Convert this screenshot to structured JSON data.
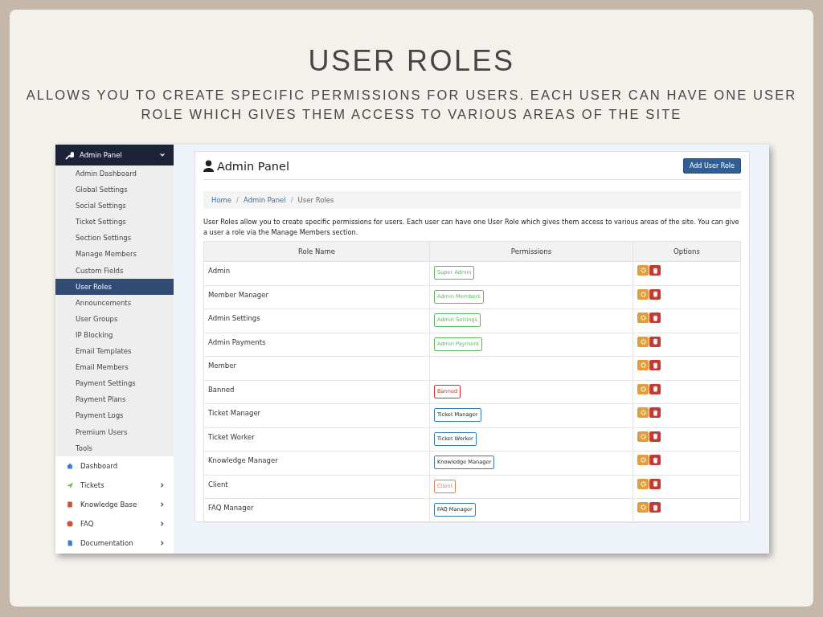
{
  "slide": {
    "title": "USER ROLES",
    "subtitle": "ALLOWS YOU TO CREATE SPECIFIC PERMISSIONS FOR USERS. EACH USER CAN HAVE ONE USER ROLE WHICH GIVES THEM ACCESS TO VARIOUS AREAS OF THE SITE"
  },
  "sidebar": {
    "section": {
      "label": "Admin Panel",
      "expanded": true
    },
    "items": [
      {
        "label": "Admin Dashboard",
        "selected": false
      },
      {
        "label": "Global Settings",
        "selected": false
      },
      {
        "label": "Social Settings",
        "selected": false
      },
      {
        "label": "Ticket Settings",
        "selected": false
      },
      {
        "label": "Section Settings",
        "selected": false
      },
      {
        "label": "Manage Members",
        "selected": false
      },
      {
        "label": "Custom Fields",
        "selected": false
      },
      {
        "label": "User Roles",
        "selected": true
      },
      {
        "label": "Announcements",
        "selected": false
      },
      {
        "label": "User Groups",
        "selected": false
      },
      {
        "label": "IP Blocking",
        "selected": false
      },
      {
        "label": "Email Templates",
        "selected": false
      },
      {
        "label": "Email Members",
        "selected": false
      },
      {
        "label": "Payment Settings",
        "selected": false
      },
      {
        "label": "Payment Plans",
        "selected": false
      },
      {
        "label": "Payment Logs",
        "selected": false
      },
      {
        "label": "Premium Users",
        "selected": false
      },
      {
        "label": "Tools",
        "selected": false
      }
    ],
    "nav": [
      {
        "label": "Dashboard",
        "kind": "home",
        "submenu": false
      },
      {
        "label": "Tickets",
        "kind": "send",
        "submenu": true
      },
      {
        "label": "Knowledge Base",
        "kind": "book",
        "submenu": true
      },
      {
        "label": "FAQ",
        "kind": "info",
        "submenu": true
      },
      {
        "label": "Documentation",
        "kind": "file",
        "submenu": true
      }
    ]
  },
  "panel": {
    "title": "Admin Panel",
    "button": "Add User Role",
    "breadcrumb": [
      "Home",
      "Admin Panel",
      "User Roles"
    ],
    "breadcrumb_separator": "/",
    "description": "User Roles allow you to create specific permissions for users. Each user can have one User Role which gives them access to various areas of the site. You can give a user a role via the Manage Members section.",
    "columns": [
      "Role Name",
      "Permissions",
      "Options"
    ],
    "rows": [
      {
        "name": "Admin",
        "tags": [
          {
            "label": "Super Admin",
            "color": "#5cb85c"
          }
        ]
      },
      {
        "name": "Member Manager",
        "tags": [
          {
            "label": "Admin Members",
            "color": "#5cb85c"
          }
        ]
      },
      {
        "name": "Admin Settings",
        "tags": [
          {
            "label": "Admin Settings",
            "color": "#5cb85c"
          }
        ]
      },
      {
        "name": "Admin Payments",
        "tags": [
          {
            "label": "Admin Payment",
            "color": "#5cb85c"
          }
        ]
      },
      {
        "name": "Member"
      },
      {
        "name": "Banned",
        "tags": [
          {
            "label": "Banned",
            "color": "#c9302c"
          }
        ]
      },
      {
        "name": "Ticket Manager",
        "tags": [
          {
            "label": "Ticket Manager",
            "color": "#337ab7"
          }
        ]
      },
      {
        "name": "Ticket Worker",
        "tags": [
          {
            "label": "Ticket Worker",
            "color": "#337ab7"
          }
        ]
      },
      {
        "name": "Knowledge Manager",
        "tags": [
          {
            "label": "Knowledge Manager",
            "color": "#337ab7"
          }
        ]
      },
      {
        "name": "Client",
        "tags": [
          {
            "label": "Client",
            "color": "#e07b53"
          }
        ]
      },
      {
        "name": "FAQ Manager",
        "tags": [
          {
            "label": "FAQ Manager",
            "color": "#337ab7"
          }
        ]
      }
    ]
  }
}
